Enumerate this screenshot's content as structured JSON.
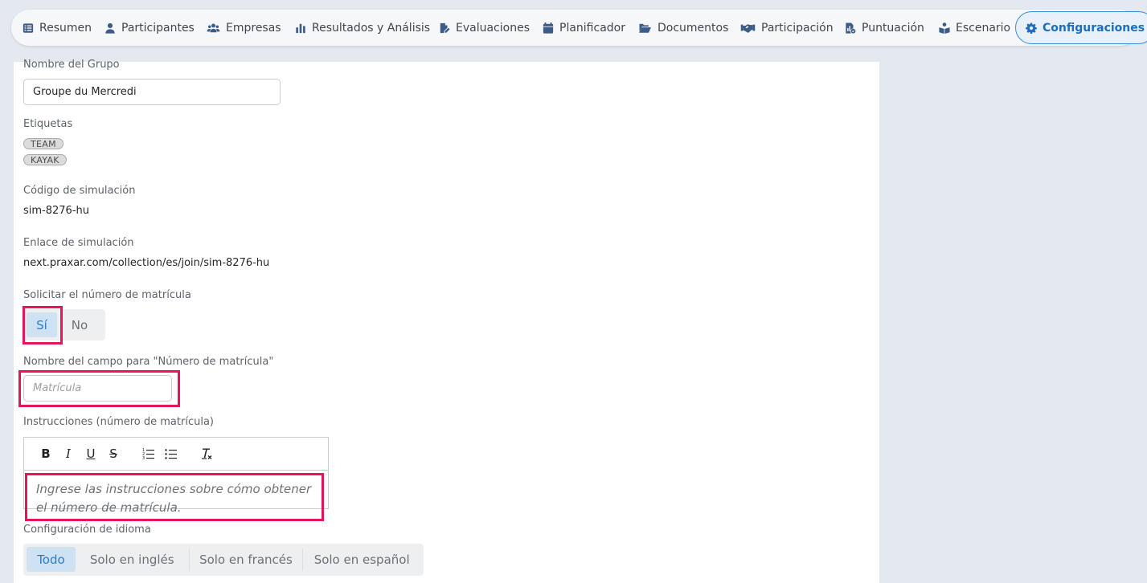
{
  "nav": {
    "items": [
      {
        "label": "Resumen",
        "icon": "list-icon"
      },
      {
        "label": "Participantes",
        "icon": "user-icon"
      },
      {
        "label": "Empresas",
        "icon": "users-icon"
      },
      {
        "label": "Resultados y Análisis",
        "icon": "bar-chart-icon"
      },
      {
        "label": "Evaluaciones",
        "icon": "file-pen-icon"
      },
      {
        "label": "Planificador",
        "icon": "calendar-icon"
      },
      {
        "label": "Documentos",
        "icon": "folder-open-icon"
      },
      {
        "label": "Participación",
        "icon": "handshake-icon"
      },
      {
        "label": "Puntuación",
        "icon": "file-chart-icon"
      },
      {
        "label": "Escenario",
        "icon": "book-reader-icon"
      },
      {
        "label": "Configuraciones",
        "icon": "gear-icon",
        "active": true
      }
    ]
  },
  "form": {
    "group_name_label": "Nombre del Grupo",
    "group_name_value": "Groupe du Mercredi",
    "tags_label": "Etiquetas",
    "tags": [
      "TEAM",
      "KAYAK"
    ],
    "sim_code_label": "Código de simulación",
    "sim_code_value": "sim-8276-hu",
    "sim_link_label": "Enlace de simulación",
    "sim_link_value": "next.praxar.com/collection/es/join/sim-8276-hu",
    "request_id_label": "Solicitar el número de matrícula",
    "request_id_options": [
      "Sí",
      "No"
    ],
    "request_id_selected": "Sí",
    "field_name_label": "Nombre del campo para \"Número de matrícula\"",
    "field_name_placeholder": "Matrícula",
    "instructions_label": "Instrucciones (número de matrícula)",
    "instructions_placeholder": "Ingrese las instrucciones sobre cómo obtener el número de matrícula.",
    "toolbar": {
      "bold": "B",
      "italic": "I",
      "underline": "U",
      "strike": "S"
    },
    "language_label": "Configuración de idioma",
    "language_options": [
      "Todo",
      "Solo en inglés",
      "Solo en francés",
      "Solo en español"
    ],
    "language_selected": "Todo"
  },
  "colors": {
    "accent": "#1e6ec0",
    "highlight": "#e6155a",
    "selected_bg": "#cfe2f3"
  }
}
